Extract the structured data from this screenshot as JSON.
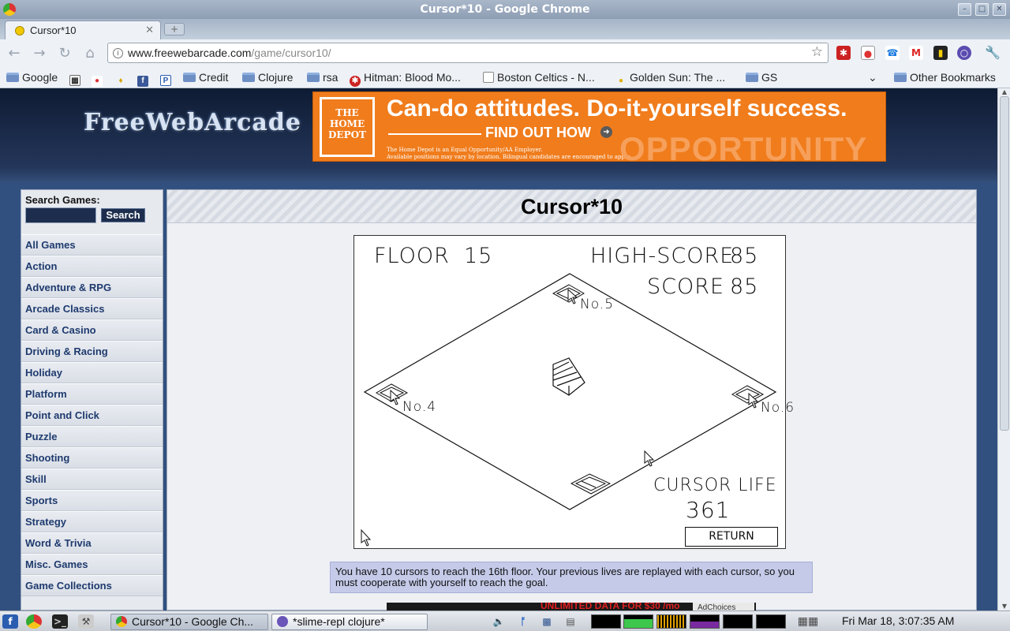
{
  "window": {
    "title": "Cursor*10 - Google Chrome"
  },
  "tab": {
    "title": "Cursor*10"
  },
  "omnibox": {
    "host": "www.freewebarcade.com",
    "path": "/game/cursor10/"
  },
  "bookmarks": [
    {
      "label": "Google",
      "icon": "folder-icon"
    },
    {
      "label": "",
      "icon": "calendar-icon"
    },
    {
      "label": "",
      "icon": "reddit-icon"
    },
    {
      "label": "",
      "icon": "leaf-icon"
    },
    {
      "label": "",
      "icon": "facebook-icon"
    },
    {
      "label": "",
      "icon": "p-icon"
    },
    {
      "label": "Credit",
      "icon": "folder-icon"
    },
    {
      "label": "Clojure",
      "icon": "folder-icon"
    },
    {
      "label": "rsa",
      "icon": "folder-icon"
    },
    {
      "label": "Hitman: Blood Mo...",
      "icon": "hitman-icon"
    },
    {
      "label": "Boston Celtics - N...",
      "icon": "page-icon"
    },
    {
      "label": "Golden Sun: The ...",
      "icon": "golden-sun-icon"
    },
    {
      "label": "GS",
      "icon": "folder-icon"
    },
    {
      "label": "Other Bookmarks",
      "icon": "folder-icon"
    }
  ],
  "site": {
    "logo": "FreeWebArcade",
    "ad": {
      "logo_text": "THE HOME DEPOT",
      "headline": "Can-do attitudes. Do-it-yourself success.",
      "cta": "FIND OUT HOW",
      "fine_print_1": "The Home Depot is an Equal Opportunity/AA Employer.",
      "fine_print_2": "Available positions may vary by location. Bilingual candidates are encouraged to apply.",
      "watermark": "OPPORTUNITY"
    },
    "search": {
      "label": "Search Games:",
      "button": "Search",
      "value": ""
    },
    "categories": [
      "All Games",
      "Action",
      "Adventure & RPG",
      "Arcade Classics",
      "Card & Casino",
      "Driving & Racing",
      "Holiday",
      "Platform",
      "Point and Click",
      "Puzzle",
      "Shooting",
      "Skill",
      "Sports",
      "Strategy",
      "Word & Trivia",
      "Misc. Games",
      "Game Collections"
    ],
    "game_title": "Cursor*10",
    "description": "You have 10 cursors to reach the 16th floor. Your previous lives are replayed with each cursor, so you must cooperate with yourself to reach the goal.",
    "bottom_ad": {
      "text": "UNLIMITED DATA FOR $30 /mo",
      "choices": "AdChoices"
    }
  },
  "game": {
    "floor_label": "FLOOR",
    "floor": "15",
    "high_score_label": "HIGH-SCORE",
    "high_score": "85",
    "score_label": "SCORE",
    "score": "85",
    "cursor_life_label": "CURSOR LIFE",
    "cursor_life": "361",
    "return_label": "RETURN",
    "switch_labels": [
      "No.5",
      "No.4",
      "No.6"
    ]
  },
  "taskbar": {
    "tasks": [
      "Cursor*10 - Google Ch...",
      "*slime-repl clojure*"
    ],
    "clock": "Fri Mar 18,  3:07:35 AM"
  }
}
